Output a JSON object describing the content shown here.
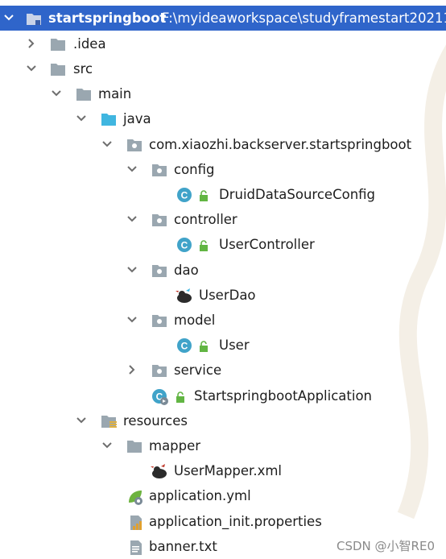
{
  "project": {
    "name": "startspringboot",
    "path": "F:\\myideaworkspace\\studyframestart20211"
  },
  "tree": {
    "idea": ".idea",
    "src": "src",
    "main": "main",
    "java": "java",
    "package": "com.xiaozhi.backserver.startspringboot",
    "config": "config",
    "druid_config": "DruidDataSourceConfig",
    "controller": "controller",
    "user_controller": "UserController",
    "dao": "dao",
    "user_dao": "UserDao",
    "model": "model",
    "user": "User",
    "service": "service",
    "application_class": "StartspringbootApplication",
    "resources": "resources",
    "mapper": "mapper",
    "user_mapper_xml": "UserMapper.xml",
    "application_yml": "application.yml",
    "application_init": "application_init.properties",
    "banner": "banner.txt"
  },
  "watermark": "CSDN @小智RE0",
  "colors": {
    "selection": "#2f65ca",
    "folder": "#9aa7b0",
    "source_folder": "#40b6e0",
    "class_icon": "#40a3c9",
    "lock": "#62b543"
  }
}
